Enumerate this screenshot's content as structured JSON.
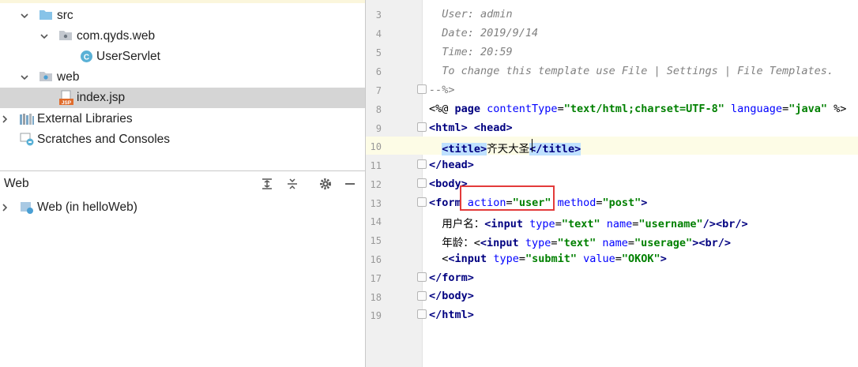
{
  "tree": {
    "src": "src",
    "package": "com.qyds.web",
    "servlet": "UserServlet",
    "web": "web",
    "index_file": "index.jsp",
    "ext_libs": "External Libraries",
    "scratches": "Scratches and Consoles"
  },
  "web_panel": {
    "title": "Web",
    "item": "Web (in helloWeb)"
  },
  "editor": {
    "line_numbers": [
      "3",
      "4",
      "5",
      "6",
      "7",
      "8",
      "9",
      "10",
      "11",
      "12",
      "13",
      "14",
      "15",
      "16",
      "17",
      "18",
      "19"
    ],
    "line3": "  User: admin",
    "line4": "  Date: 2019/9/14",
    "line5": "  Time: 20:59",
    "line6": "  To change this template use File | Settings | File Templates.",
    "line7": "--%>",
    "l8": {
      "open": "<%@ ",
      "page": "page ",
      "a1": "contentType",
      "eq1": "=",
      "v1": "\"text/html;charset=UTF-8\"",
      "a2": " language",
      "eq2": "=",
      "v2": "\"java\"",
      "close": " %>"
    },
    "l9": {
      "t1": "<html>",
      "sp": " ",
      "t2": "<head>"
    },
    "l10": {
      "ind": "  ",
      "t1": "<title>",
      "txt": "齐天大圣",
      "t2": "</title>"
    },
    "l11": "</head>",
    "l12": "<body>",
    "l13": {
      "t1": "<form",
      "a1": " action",
      "eq1": "=",
      "v1": "\"user\"",
      "a2": " method",
      "eq2": "=",
      "v2": "\"post\"",
      "t2": ">"
    },
    "l14": {
      "ind": "  ",
      "txt": "用户名：",
      "t1": "<input",
      "a1": " type",
      "eq1": "=",
      "v1": "\"text\"",
      "a2": " name",
      "eq2": "=",
      "v2": "\"username\"",
      "t2": "/>",
      "t3": "<br/>"
    },
    "l15": {
      "ind": "  ",
      "txt": "年龄：",
      "lt": "<",
      "t1": "<input",
      "a1": " type",
      "eq1": "=",
      "v1": "\"text\"",
      "a2": " name",
      "eq2": "=",
      "v2": "\"userage\"",
      "t2": ">",
      "t3": "<br/>"
    },
    "l16": {
      "ind": "  ",
      "lt": "<",
      "t1": "<input",
      "a1": " type",
      "eq1": "=",
      "v1": "\"submit\"",
      "a2": " value",
      "eq2": "=",
      "v2": "\"OKOK\"",
      "t2": ">"
    },
    "l17": "</form>",
    "l18": "</body>",
    "l19": "</html>"
  },
  "colors": {
    "selection": "#d5d5d5",
    "highlight_box": "#e33b3b",
    "current_line": "#fdfce6"
  }
}
